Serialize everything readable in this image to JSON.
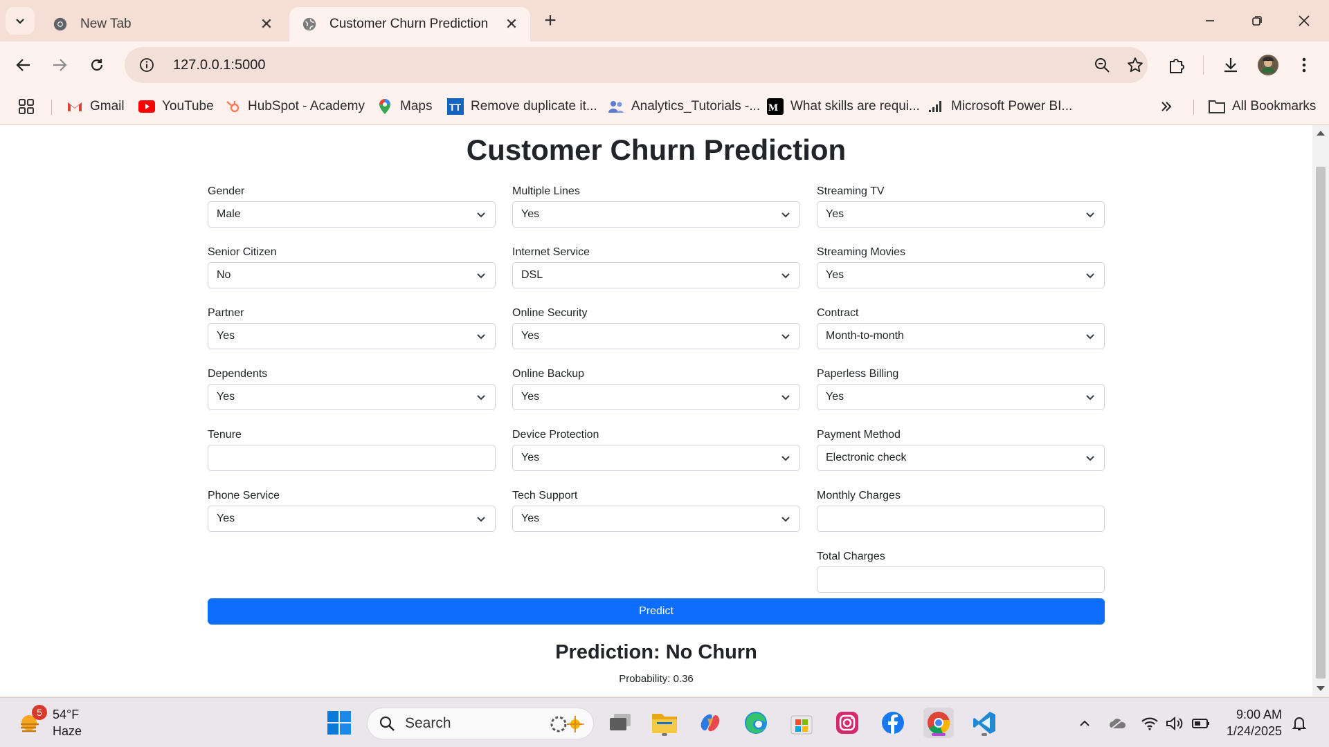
{
  "browser": {
    "tabs": [
      {
        "title": "New Tab",
        "active": false
      },
      {
        "title": "Customer Churn Prediction",
        "active": true
      }
    ],
    "url": "127.0.0.1:5000",
    "bookmarks": [
      {
        "label": "Gmail",
        "icon": "gmail-icon"
      },
      {
        "label": "YouTube",
        "icon": "youtube-icon"
      },
      {
        "label": "HubSpot - Academy",
        "icon": "hubspot-icon"
      },
      {
        "label": "Maps",
        "icon": "maps-icon"
      },
      {
        "label": "Remove duplicate it...",
        "icon": "tt-icon"
      },
      {
        "label": "Analytics_Tutorials -...",
        "icon": "people-icon"
      },
      {
        "label": "What skills are requi...",
        "icon": "medium-icon"
      },
      {
        "label": "Microsoft Power BI...",
        "icon": "powerbi-icon"
      }
    ],
    "all_bookmarks_label": "All Bookmarks"
  },
  "page": {
    "title": "Customer Churn Prediction",
    "columns": [
      [
        {
          "label": "Gender",
          "type": "select",
          "value": "Male"
        },
        {
          "label": "Senior Citizen",
          "type": "select",
          "value": "No"
        },
        {
          "label": "Partner",
          "type": "select",
          "value": "Yes"
        },
        {
          "label": "Dependents",
          "type": "select",
          "value": "Yes"
        },
        {
          "label": "Tenure",
          "type": "input",
          "value": ""
        },
        {
          "label": "Phone Service",
          "type": "select",
          "value": "Yes"
        }
      ],
      [
        {
          "label": "Multiple Lines",
          "type": "select",
          "value": "Yes"
        },
        {
          "label": "Internet Service",
          "type": "select",
          "value": "DSL"
        },
        {
          "label": "Online Security",
          "type": "select",
          "value": "Yes"
        },
        {
          "label": "Online Backup",
          "type": "select",
          "value": "Yes"
        },
        {
          "label": "Device Protection",
          "type": "select",
          "value": "Yes"
        },
        {
          "label": "Tech Support",
          "type": "select",
          "value": "Yes"
        }
      ],
      [
        {
          "label": "Streaming TV",
          "type": "select",
          "value": "Yes"
        },
        {
          "label": "Streaming Movies",
          "type": "select",
          "value": "Yes"
        },
        {
          "label": "Contract",
          "type": "select",
          "value": "Month-to-month"
        },
        {
          "label": "Paperless Billing",
          "type": "select",
          "value": "Yes"
        },
        {
          "label": "Payment Method",
          "type": "select",
          "value": "Electronic check"
        },
        {
          "label": "Monthly Charges",
          "type": "input",
          "value": ""
        },
        {
          "label": "Total Charges",
          "type": "input",
          "value": ""
        }
      ]
    ],
    "predict_label": "Predict",
    "prediction_text": "Prediction: No Churn",
    "probability_text": "Probability: 0.36"
  },
  "taskbar": {
    "weather_temp": "54°F",
    "weather_desc": "Haze",
    "weather_badge": "5",
    "search_label": "Search",
    "time": "9:00 AM",
    "date": "1/24/2025"
  },
  "colors": {
    "accent": "#0d6efd",
    "tab_strip": "#f4ded5",
    "toolbar": "#fdf2ee"
  }
}
